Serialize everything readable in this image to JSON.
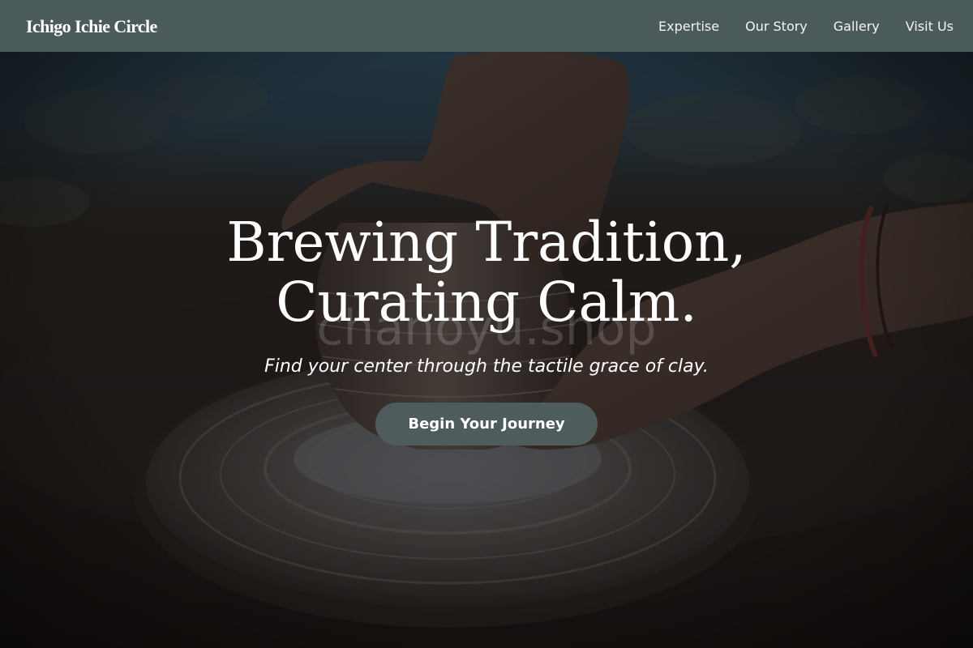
{
  "nav": {
    "brand": "Ichigo Ichie Circle",
    "links": [
      {
        "label": "Expertise"
      },
      {
        "label": "Our Story"
      },
      {
        "label": "Gallery"
      },
      {
        "label": "Visit Us"
      }
    ]
  },
  "hero": {
    "title": "Brewing Tradition, Curating Calm.",
    "subtitle": "Find your center through the tactile grace of clay.",
    "cta_label": "Begin Your Journey",
    "watermark": "chanoyu.shop",
    "background_image": "hands-shaping-clay-pot-on-pottery-wheel"
  },
  "colors": {
    "navbar": "#4b5b59",
    "cta": "#4e5d5b",
    "text": "#ffffff"
  }
}
